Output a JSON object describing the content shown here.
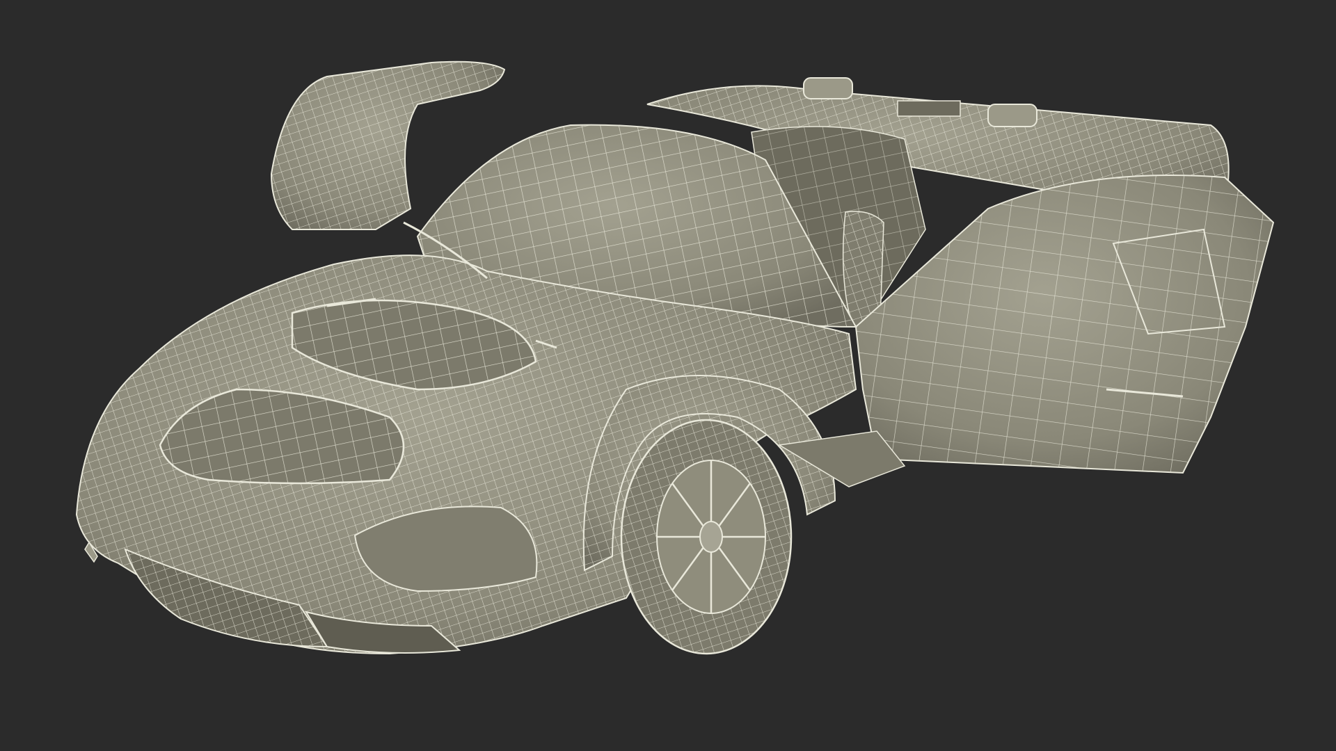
{
  "scene": {
    "subject": "wireframe-sports-car",
    "render_style": "wireframe-over-clay",
    "background_color": "#2b2b2b",
    "clay_color": "#8f8d7c",
    "clay_shadow_color": "#6d6b5d",
    "clay_highlight_color": "#a6a494",
    "wire_color": "#e9e8da",
    "doors_open": true,
    "visible_parts": [
      "front-clamshell",
      "windshield",
      "open-gullwing-door-left",
      "open-gullwing-door-right",
      "front-wheel",
      "front-grille",
      "roof-scoops",
      "seat"
    ]
  }
}
